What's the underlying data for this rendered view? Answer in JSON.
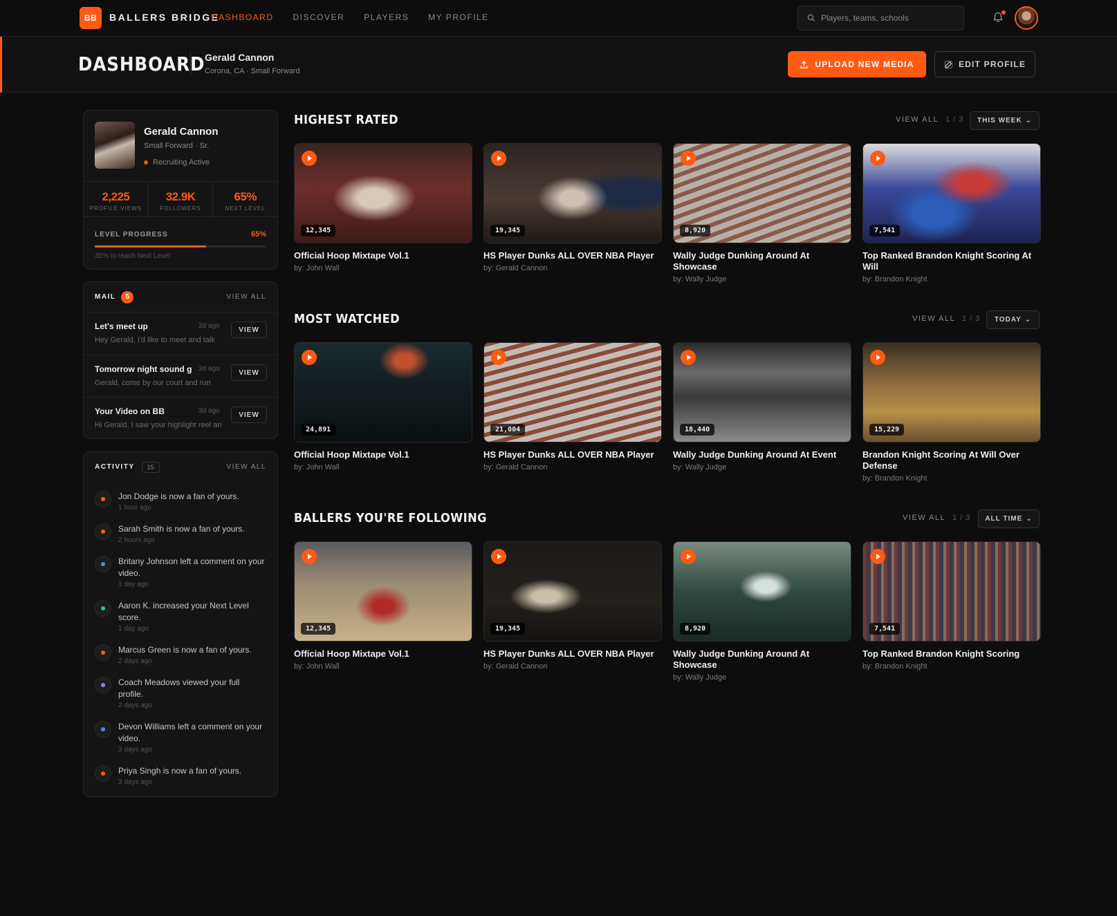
{
  "brand": {
    "logo_text": "BB",
    "name": "BALLERS BRIDGE"
  },
  "nav": {
    "links": [
      {
        "label": "DASHBOARD"
      },
      {
        "label": "DISCOVER"
      },
      {
        "label": "PLAYERS"
      },
      {
        "label": "MY PROFILE"
      }
    ],
    "active": "DASHBOARD"
  },
  "search": {
    "placeholder": "Players, teams, schools"
  },
  "header": {
    "title": "DASHBOARD",
    "name": "Gerald Cannon",
    "subtitle": "Corona, CA · Small Forward",
    "upload_label": "UPLOAD NEW MEDIA",
    "edit_label": "EDIT PROFILE"
  },
  "profile": {
    "name": "Gerald Cannon",
    "role": "Small Forward · Sr.",
    "status": "Recruiting Active",
    "stats": [
      {
        "value": "2,225",
        "label": "PROFILE VIEWS"
      },
      {
        "value": "32.9K",
        "label": "FOLLOWERS"
      },
      {
        "value": "65%",
        "label": "NEXT LEVEL"
      }
    ],
    "level_label": "LEVEL PROGRESS",
    "level_pct_text": "65%",
    "level_fraction": 0.65,
    "level_note": "35% to reach Next Level"
  },
  "mail": {
    "title": "MAIL",
    "count": "5",
    "view_all": "VIEW ALL",
    "items": [
      {
        "subject": "Let's meet up",
        "time": "2d ago",
        "preview": "Hey Gerald, I'd like to meet and talk",
        "action": "VIEW"
      },
      {
        "subject": "Tomorrow night sound g",
        "time": "3d ago",
        "preview": "Gerald, come by our court and run",
        "action": "VIEW"
      },
      {
        "subject": "Your Video on BB",
        "time": "3d ago",
        "preview": "Hi Gerald, I saw your highlight reel and",
        "action": "VIEW"
      }
    ]
  },
  "activity": {
    "title": "ACTIVITY",
    "count": "15",
    "view_all": "VIEW ALL",
    "items": [
      {
        "text": "Jon Dodge is now a fan of yours.",
        "time": "1 hour ago",
        "color": "#ff5a14"
      },
      {
        "text": "Sarah Smith is now a fan of yours.",
        "time": "2 hours ago",
        "color": "#ff5a14"
      },
      {
        "text": "Britany Johnson left a comment on your video.",
        "time": "1 day ago",
        "color": "#4a90e2"
      },
      {
        "text": "Aaron K. increased your Next Level score.",
        "time": "1 day ago",
        "color": "#2ecc71"
      },
      {
        "text": "Marcus Green is now a fan of yours.",
        "time": "2 days ago",
        "color": "#ff5a14"
      },
      {
        "text": "Coach Meadows viewed your full profile.",
        "time": "2 days ago",
        "color": "#9b7be6"
      },
      {
        "text": "Devon Williams left a comment on your video.",
        "time": "3 days ago",
        "color": "#4a90e2"
      },
      {
        "text": "Priya Singh is now a fan of yours.",
        "time": "3 days ago",
        "color": "#ff5a14"
      }
    ]
  },
  "sections": [
    {
      "title": "HIGHEST RATED",
      "view_all": "VIEW ALL",
      "page": "1 / 3",
      "filter": "THIS WEEK",
      "videos": [
        {
          "views": "12,345",
          "title": "Official Hoop Mixtape Vol.1",
          "by": "by: John Wall"
        },
        {
          "views": "19,345",
          "title": "HS Player Dunks ALL OVER NBA Player",
          "by": "by: Gerald Cannon"
        },
        {
          "views": "8,920",
          "title": "Wally Judge Dunking Around At Showcase",
          "by": "by: Wally Judge"
        },
        {
          "views": "7,541",
          "title": "Top Ranked Brandon Knight Scoring At Will",
          "by": "by: Brandon Knight"
        }
      ]
    },
    {
      "title": "MOST WATCHED",
      "view_all": "VIEW ALL",
      "page": "1 / 3",
      "filter": "TODAY",
      "videos": [
        {
          "views": "24,891",
          "title": "Official Hoop Mixtape Vol.1",
          "by": "by: John Wall"
        },
        {
          "views": "21,004",
          "title": "HS Player Dunks ALL OVER NBA Player",
          "by": "by: Gerald Cannon"
        },
        {
          "views": "18,440",
          "title": "Wally Judge Dunking Around At Event",
          "by": "by: Wally Judge"
        },
        {
          "views": "15,229",
          "title": "Brandon Knight Scoring At Will Over Defense",
          "by": "by: Brandon Knight"
        }
      ]
    },
    {
      "title": "BALLERS YOU'RE FOLLOWING",
      "view_all": "VIEW ALL",
      "page": "1 / 3",
      "filter": "ALL TIME",
      "videos": [
        {
          "views": "12,345",
          "title": "Official Hoop Mixtape Vol.1",
          "by": "by: John Wall"
        },
        {
          "views": "19,345",
          "title": "HS Player Dunks ALL OVER NBA Player",
          "by": "by: Gerald Cannon"
        },
        {
          "views": "8,920",
          "title": "Wally Judge Dunking Around At Showcase",
          "by": "by: Wally Judge"
        },
        {
          "views": "7,541",
          "title": "Top Ranked Brandon Knight Scoring",
          "by": "by: Brandon Knight"
        }
      ]
    }
  ]
}
